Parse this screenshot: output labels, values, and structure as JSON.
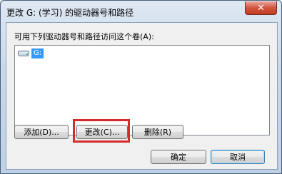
{
  "window": {
    "title": "更改 G: (学习) 的驱动器号和路径",
    "close_glyph": "✕"
  },
  "dialog": {
    "prompt": "可用下列驱动器号和路径访问这个卷(A):",
    "items": [
      {
        "label": "G:",
        "icon": "drive-icon"
      }
    ]
  },
  "buttons": {
    "add": "添加(D)...",
    "change": "更改(C)...",
    "delete": "删除(R)",
    "ok": "确定",
    "cancel": "取消"
  },
  "colors": {
    "highlight": "#d42b2b",
    "selection": "#3399ff"
  }
}
